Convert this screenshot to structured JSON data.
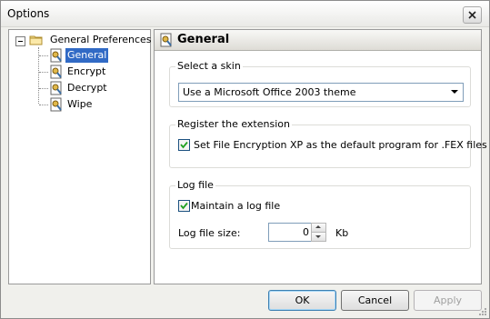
{
  "window": {
    "title": "Options"
  },
  "tree": {
    "root_label": "General Preferences",
    "items": [
      {
        "label": "General",
        "selected": true
      },
      {
        "label": "Encrypt",
        "selected": false
      },
      {
        "label": "Decrypt",
        "selected": false
      },
      {
        "label": "Wipe",
        "selected": false
      }
    ]
  },
  "panel": {
    "title": "General",
    "skin": {
      "group_title": "Select a skin",
      "selected_value": "Use a Microsoft Office 2003 theme"
    },
    "extension": {
      "group_title": "Register the extension",
      "checkbox_label": "Set File Encryption XP as the default program for .FEX files",
      "checked": true
    },
    "logfile": {
      "group_title": "Log file",
      "checkbox_label": "Maintain a log file",
      "checked": true,
      "size_label": "Log file size:",
      "size_value": "0",
      "size_unit": "Kb"
    }
  },
  "buttons": {
    "ok": "OK",
    "cancel": "Cancel",
    "apply": "Apply"
  },
  "colors": {
    "selection": "#316ac5",
    "panel_header": "#e4e2dc",
    "window_bg": "#f0f0ec"
  }
}
